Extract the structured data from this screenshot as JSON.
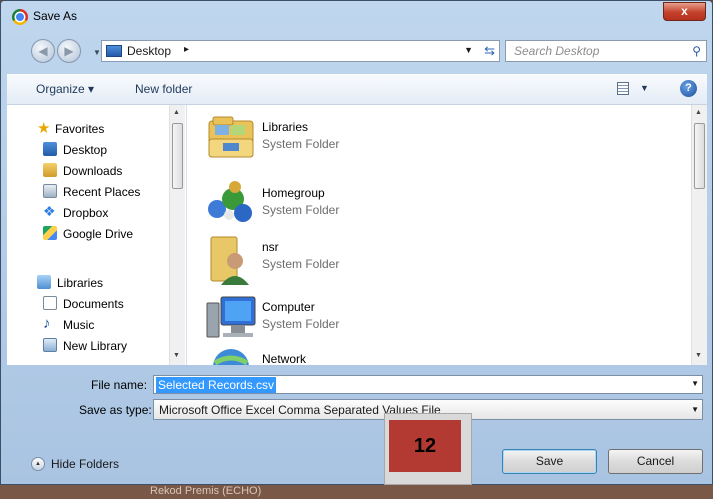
{
  "window": {
    "title": "Save As",
    "close_label": "x"
  },
  "address": {
    "location": "Desktop",
    "search_placeholder": "Search Desktop"
  },
  "toolbar": {
    "organize": "Organize ▾",
    "new_folder": "New folder"
  },
  "sidebar": {
    "favorites_header": "Favorites",
    "favorites": [
      "Desktop",
      "Downloads",
      "Recent Places",
      "Dropbox",
      "Google Drive"
    ],
    "libraries_header": "Libraries",
    "libraries": [
      "Documents",
      "Music",
      "New Library"
    ]
  },
  "files": [
    {
      "name": "Libraries",
      "type": "System Folder",
      "icon": "libraries-icon"
    },
    {
      "name": "Homegroup",
      "type": "System Folder",
      "icon": "homegroup-icon"
    },
    {
      "name": "nsr",
      "type": "System Folder",
      "icon": "user-folder-icon"
    },
    {
      "name": "Computer",
      "type": "System Folder",
      "icon": "computer-icon"
    },
    {
      "name": "Network",
      "type": "",
      "icon": "network-icon"
    }
  ],
  "form": {
    "file_name_label": "File name:",
    "file_name_value": "Selected Records.csv",
    "save_type_label": "Save as type:",
    "save_type_value": "Microsoft Office Excel Comma Separated Values File"
  },
  "buttons": {
    "hide_folders": "Hide Folders",
    "save": "Save",
    "cancel": "Cancel"
  },
  "annotation": {
    "step": "12"
  },
  "background_text": "Rekod Premis (ECHO)",
  "colors": {
    "selection": "#3399ff",
    "badge": "#b23a33",
    "frame": "#a9c4e2"
  }
}
